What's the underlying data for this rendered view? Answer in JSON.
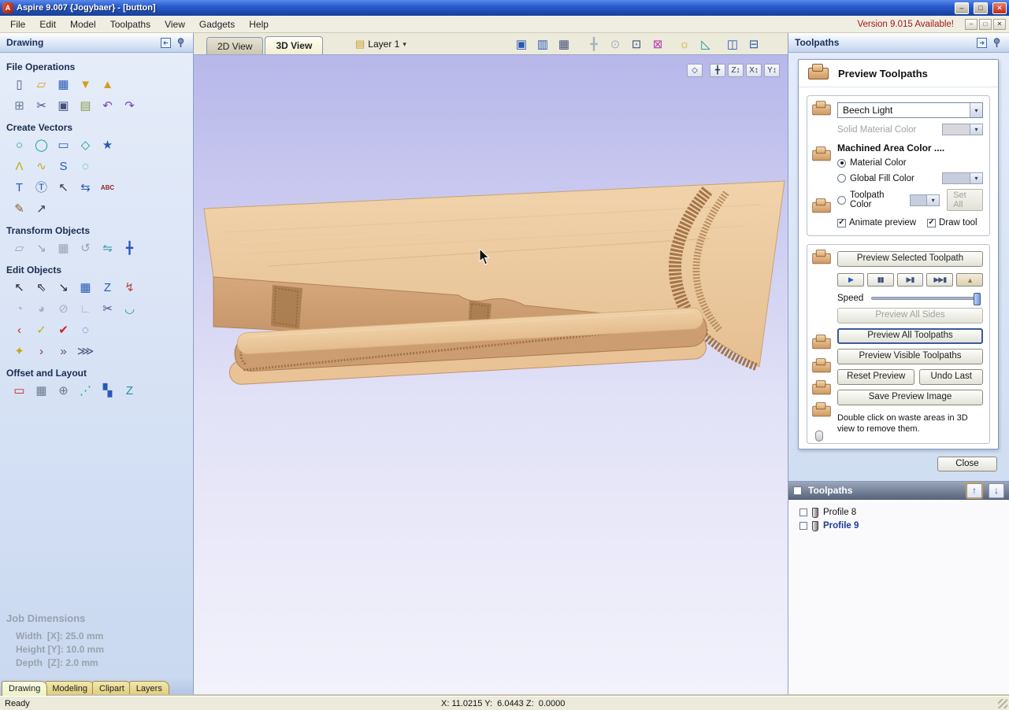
{
  "window": {
    "title": "Aspire 9.007 {Jogybaer} - [button]",
    "app_initial": "A",
    "controls": {
      "minimize": "–",
      "maximize": "□",
      "close": "✕"
    }
  },
  "menu": {
    "items": [
      {
        "label": "File",
        "name": "menu-file"
      },
      {
        "label": "Edit",
        "name": "menu-edit"
      },
      {
        "label": "Model",
        "name": "menu-model"
      },
      {
        "label": "Toolpaths",
        "name": "menu-toolpaths"
      },
      {
        "label": "View",
        "name": "menu-view"
      },
      {
        "label": "Gadgets",
        "name": "menu-gadgets"
      },
      {
        "label": "Help",
        "name": "menu-help"
      }
    ],
    "version_notice": "Version 9.015 Available!",
    "mdi": {
      "minimize": "–",
      "restore": "□",
      "close": "✕"
    }
  },
  "glyphs": {
    "combo_arrow": "▾",
    "up_arrow": "↑",
    "down_arrow": "↓",
    "check": "✓",
    "layers_icon": "▤"
  },
  "colors": {
    "wood_material": "#ecc9a0",
    "canvas_background": "#c3c3ee",
    "selection_blue": "#1a3a9a",
    "version_notice_red": "#a01818"
  },
  "drawing_panel": {
    "title": "Drawing",
    "section_titles": {
      "file_operations": "File Operations",
      "create_vectors": "Create Vectors",
      "transform_objects": "Transform Objects",
      "edit_objects": "Edit Objects",
      "offset_layout": "Offset and Layout"
    },
    "icons": {
      "file_ops_row1": [
        {
          "name": "new-file-icon",
          "glyph": "▯",
          "color": "#4a5a78"
        },
        {
          "name": "open-file-icon",
          "glyph": "▱",
          "color": "#d89c1a"
        },
        {
          "name": "save-file-icon",
          "glyph": "▦",
          "color": "#2a58b8"
        },
        {
          "name": "import-vectors-icon",
          "glyph": "▼",
          "color": "#d89c1a"
        },
        {
          "name": "export-vectors-icon",
          "glyph": "▲",
          "color": "#d89c1a"
        }
      ],
      "file_ops_row2": [
        {
          "name": "job-setup-icon",
          "glyph": "⊞",
          "color": "#6a7a90"
        },
        {
          "name": "cut-icon",
          "glyph": "✂",
          "color": "#44507a"
        },
        {
          "name": "copy-icon",
          "glyph": "▣",
          "color": "#44507a"
        },
        {
          "name": "paste-icon",
          "glyph": "▤",
          "color": "#8a9a4a"
        },
        {
          "name": "undo-icon",
          "glyph": "↶",
          "color": "#7a3db8"
        },
        {
          "name": "redo-icon",
          "glyph": "↷",
          "color": "#7a3db8"
        }
      ],
      "create_vectors_row1": [
        {
          "name": "draw-circle-icon",
          "glyph": "○",
          "color": "#159a94"
        },
        {
          "name": "draw-ellipse-icon",
          "glyph": "◯",
          "color": "#159a94"
        },
        {
          "name": "draw-rectangle-icon",
          "glyph": "▭",
          "color": "#2a58b8"
        },
        {
          "name": "draw-polygon-icon",
          "glyph": "◇",
          "color": "#159a94"
        },
        {
          "name": "draw-star-icon",
          "glyph": "★",
          "color": "#2a58b8"
        }
      ],
      "create_vectors_row2": [
        {
          "name": "draw-polyline-icon",
          "glyph": "Λ",
          "color": "#c8a818"
        },
        {
          "name": "draw-curve-icon",
          "glyph": "∿",
          "color": "#c8a818"
        },
        {
          "name": "draw-bezier-icon",
          "glyph": "S",
          "color": "#2a58b8"
        },
        {
          "name": "draw-arc-icon",
          "glyph": "◌",
          "color": "#159a94"
        }
      ],
      "create_vectors_row3": [
        {
          "name": "draw-text-icon",
          "glyph": "T",
          "color": "#2a58b8"
        },
        {
          "name": "text-box-icon",
          "glyph": "Ⓣ",
          "color": "#2a58b8"
        },
        {
          "name": "text-select-icon",
          "glyph": "↖",
          "color": "#333344"
        },
        {
          "name": "text-spacing-icon",
          "glyph": "⇆",
          "color": "#2a58b8"
        },
        {
          "name": "text-abc-icon",
          "glyph": "ABC",
          "color": "#8a2a2a",
          "small": true
        }
      ],
      "create_vectors_row4": [
        {
          "name": "text-on-curve-icon",
          "glyph": "✎",
          "color": "#8a5a2a"
        },
        {
          "name": "measure-icon",
          "glyph": "↗",
          "color": "#333344"
        }
      ],
      "transform_row1": [
        {
          "name": "free-transform-icon",
          "glyph": "▱",
          "color": "#9aa4b0"
        },
        {
          "name": "set-size-icon",
          "glyph": "↘",
          "color": "#9aa4b0"
        },
        {
          "name": "align-objects-icon",
          "glyph": "▦",
          "color": "#9aa4b0"
        },
        {
          "name": "rotate-objects-icon",
          "glyph": "↺",
          "color": "#9aa4b0"
        },
        {
          "name": "mirror-objects-icon",
          "glyph": "⇋",
          "color": "#159a94"
        },
        {
          "name": "move-objects-icon",
          "glyph": "╋",
          "color": "#2a58b8"
        }
      ],
      "edit_row1": [
        {
          "name": "select-tool-icon",
          "glyph": "↖",
          "color": "#222233"
        },
        {
          "name": "node-edit-icon",
          "glyph": "⇖",
          "color": "#222233"
        },
        {
          "name": "interactive-selection-icon",
          "glyph": "↘",
          "color": "#222233"
        },
        {
          "name": "group-objects-icon",
          "glyph": "▦",
          "color": "#2a58b8"
        },
        {
          "name": "object-order-icon",
          "glyph": "Z",
          "color": "#2a58b8"
        },
        {
          "name": "quick-layout-icon",
          "glyph": "↯",
          "color": "#b84444"
        }
      ],
      "edit_row2": [
        {
          "name": "offset-vectors-icon",
          "glyph": "◔",
          "color": "#aab0bc"
        },
        {
          "name": "weld-vectors-icon",
          "glyph": "◕",
          "color": "#aab0bc"
        },
        {
          "name": "subtract-vectors-icon",
          "glyph": "⊘",
          "color": "#aab0bc"
        },
        {
          "name": "slice-vectors-icon",
          "glyph": "∟",
          "color": "#aab0bc"
        },
        {
          "name": "scissor-trim-icon",
          "glyph": "✂",
          "color": "#44507a"
        },
        {
          "name": "fillet-tool-icon",
          "glyph": "◡",
          "color": "#159a94"
        }
      ],
      "edit_row3": [
        {
          "name": "fit-arcs-icon",
          "glyph": "‹",
          "color": "#cc2222"
        },
        {
          "name": "join-vectors-icon",
          "glyph": "✓",
          "color": "#c8a818"
        },
        {
          "name": "validate-vectors-icon",
          "glyph": "✔",
          "color": "#cc2222"
        },
        {
          "name": "node-circle-icon",
          "glyph": "◌",
          "color": "#2a58b8"
        }
      ],
      "edit_row4": [
        {
          "name": "sharpen-corners-icon",
          "glyph": "✦",
          "color": "#c8a818"
        },
        {
          "name": "extend-vector-icon",
          "glyph": "›",
          "color": "#8a2a5a"
        },
        {
          "name": "close-vector-icon",
          "glyph": "»",
          "color": "#7a3d8a"
        },
        {
          "name": "smooth-vector-icon",
          "glyph": "⋙",
          "color": "#44507a"
        }
      ],
      "offset_layout_row1": [
        {
          "name": "offset-selection-icon",
          "glyph": "▭",
          "color": "#cc2222"
        },
        {
          "name": "array-copy-icon",
          "glyph": "▦",
          "color": "#6a7a90"
        },
        {
          "name": "circular-array-icon",
          "glyph": "⊕",
          "color": "#6a7a90"
        },
        {
          "name": "copy-along-vectors-icon",
          "glyph": "⋰",
          "color": "#159a94"
        },
        {
          "name": "block-layout-icon",
          "glyph": "▚",
          "color": "#2a58b8"
        },
        {
          "name": "nest-parts-icon",
          "glyph": "Z",
          "color": "#159a94"
        }
      ]
    },
    "job_dimensions": {
      "title": "Job Dimensions",
      "width": "Width  [X]: 25.0 mm",
      "height": "Height [Y]: 10.0 mm",
      "depth": "Depth  [Z]: 2.0 mm"
    },
    "tabs": [
      {
        "label": "Drawing",
        "name": "tab-drawing",
        "active": true
      },
      {
        "label": "Modeling",
        "name": "tab-modeling"
      },
      {
        "label": "Clipart",
        "name": "tab-clipart"
      },
      {
        "label": "Layers",
        "name": "tab-layers"
      }
    ]
  },
  "view_area": {
    "tabs": [
      {
        "label": "2D View",
        "name": "tab-2d-view"
      },
      {
        "label": "3D View",
        "name": "tab-3d-view",
        "active": true
      }
    ],
    "layer_selector": {
      "label": "Layer 1"
    },
    "toolbar": {
      "group1": [
        {
          "name": "toggle-single-view-icon",
          "glyph": "▣",
          "color": "#2a58b8"
        },
        {
          "name": "tile-views-icon",
          "glyph": "▥",
          "color": "#2a58b8"
        },
        {
          "name": "snap-grid-icon",
          "glyph": "▦",
          "color": "#44507a"
        }
      ],
      "group2": [
        {
          "name": "pan-view-icon",
          "glyph": "╋",
          "color": "#a8b0bc"
        },
        {
          "name": "zoom-tool-icon",
          "glyph": "⊙",
          "color": "#a8b0bc"
        },
        {
          "name": "zoom-window-icon",
          "glyph": "⊡",
          "color": "#44507a"
        },
        {
          "name": "zoom-selected-icon",
          "glyph": "⊠",
          "color": "#b83ab0"
        }
      ],
      "group3": [
        {
          "name": "shading-toggle-icon",
          "glyph": "☼",
          "color": "#c8a818"
        },
        {
          "name": "measure-angle-icon",
          "glyph": "◺",
          "color": "#159a94"
        }
      ],
      "group4": [
        {
          "name": "tile-horizontal-icon",
          "glyph": "◫",
          "color": "#2a58b8"
        },
        {
          "name": "tile-vertical-icon",
          "glyph": "⊟",
          "color": "#2a58b8"
        }
      ]
    },
    "orientation": [
      {
        "name": "iso-view-icon",
        "glyph": "◇",
        "gap": true
      },
      {
        "name": "rotate-view-icon",
        "glyph": "╋"
      },
      {
        "name": "z-axis-view-icon",
        "glyph": "Z↕"
      },
      {
        "name": "x-axis-view-icon",
        "glyph": "X↕"
      },
      {
        "name": "y-axis-view-icon",
        "glyph": "Y↕"
      }
    ]
  },
  "toolpaths_panel": {
    "title": "Toolpaths",
    "preview": {
      "title": "Preview Toolpaths",
      "material": "Beech Light",
      "solid_material_color_label": "Solid Material Color",
      "machined_area_label": "Machined Area Color ....",
      "radios": [
        {
          "label": "Material Color",
          "checked": true
        },
        {
          "label": "Global Fill Color",
          "checked": false
        },
        {
          "label": "Toolpath Color",
          "checked": false
        }
      ],
      "set_all_label": "Set All",
      "checkboxes": [
        {
          "label": "Animate preview",
          "checked": true
        },
        {
          "label": "Draw tool",
          "checked": true
        }
      ],
      "speed_label": "Speed",
      "playback": [
        {
          "name": "play-button",
          "glyph": "▶",
          "color": "#2a58b8"
        },
        {
          "name": "pause-button",
          "glyph": "▮▮",
          "color": "#44507a"
        },
        {
          "name": "step-button",
          "glyph": "▶▮",
          "color": "#44507a"
        },
        {
          "name": "skip-end-button",
          "glyph": "▶▶▮",
          "color": "#44507a"
        },
        {
          "name": "finish-button",
          "glyph": "▲",
          "color": "#8a7a4a",
          "muted": true
        }
      ],
      "buttons": {
        "preview_selected": "Preview Selected Toolpath",
        "preview_all_sides": "Preview All Sides",
        "preview_all": "Preview All Toolpaths",
        "preview_visible": "Preview Visible Toolpaths",
        "reset": "Reset Preview",
        "undo_last": "Undo Last",
        "save_image": "Save Preview Image"
      },
      "note": "Double click on waste areas in 3D view to remove them.",
      "close_label": "Close"
    },
    "list": {
      "title": "Toolpaths",
      "items": [
        {
          "label": "Profile 8",
          "selected": false
        },
        {
          "label": "Profile 9",
          "selected": true
        }
      ]
    }
  },
  "status_bar": {
    "ready": "Ready",
    "coordinates": "X: 11.0215 Y:  6.0443 Z:  0.0000"
  }
}
